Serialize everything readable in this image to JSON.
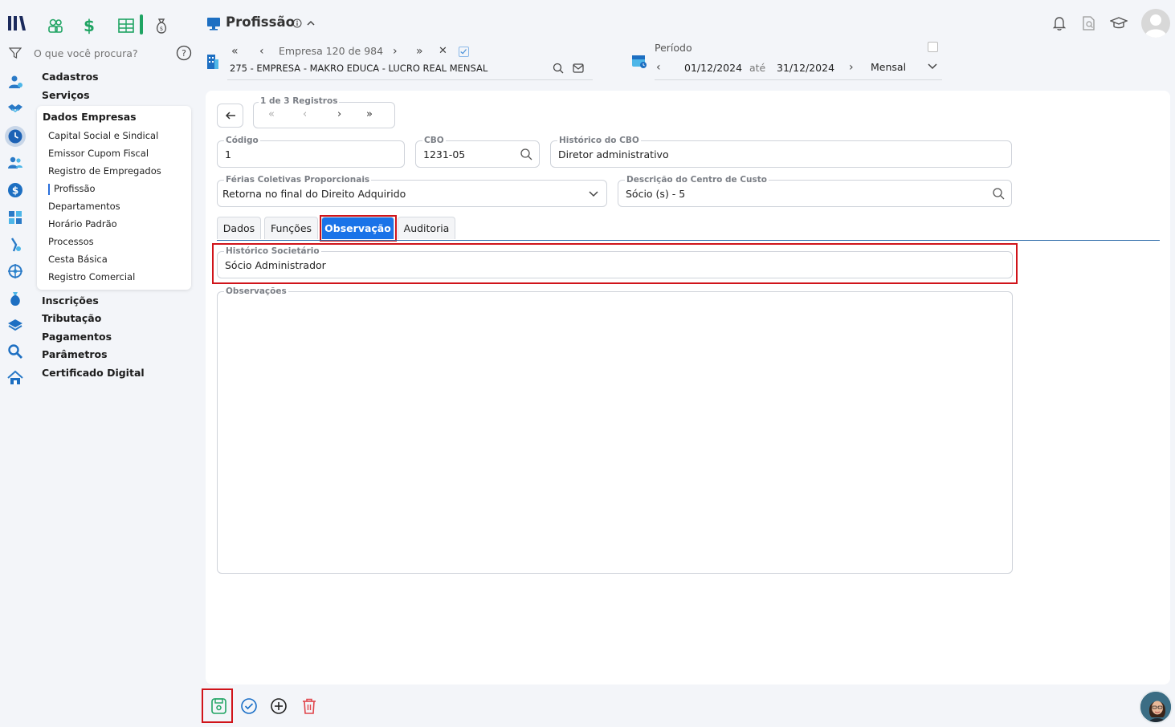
{
  "app": {
    "search_placeholder": "O que você procura?",
    "page_title": "Profissão"
  },
  "menu": {
    "items_top": [
      "Cadastros",
      "Serviços"
    ],
    "group_title": "Dados Empresas",
    "sub_items": [
      "Capital Social e Sindical",
      "Emissor Cupom Fiscal",
      "Registro de Empregados",
      "Profissão",
      "Departamentos",
      "Horário Padrão",
      "Processos",
      "Cesta Básica",
      "Registro Comercial"
    ],
    "items_bottom": [
      "Inscrições",
      "Tributação",
      "Pagamentos",
      "Parâmetros",
      "Certificado Digital"
    ]
  },
  "company_nav": {
    "label": "Empresa",
    "current": "120",
    "de": "de",
    "total": "984",
    "company_name": "275 - EMPRESA - MAKRO EDUCA - LUCRO REAL MENSAL"
  },
  "period": {
    "label": "Período",
    "start": "01/12/2024",
    "ate": "até",
    "end": "31/12/2024",
    "mode": "Mensal"
  },
  "records": {
    "label": "1 de 3 Registros"
  },
  "form": {
    "codigo": {
      "label": "Código",
      "value": "1"
    },
    "cbo": {
      "label": "CBO",
      "value": "1231-05"
    },
    "historico_cbo": {
      "label": "Histórico do CBO",
      "value": "Diretor administrativo"
    },
    "ferias": {
      "label": "Férias Coletivas Proporcionais",
      "value": "Retorna no final do Direito Adquirido"
    },
    "centro_custo": {
      "label": "Descrição do Centro de Custo",
      "value": "Sócio (s) - 5"
    },
    "historico_societario": {
      "label": "Histórico Societário",
      "value": "Sócio Administrador"
    },
    "observacoes": {
      "label": "Observações",
      "value": ""
    }
  },
  "tabs": [
    "Dados",
    "Funções",
    "Observação",
    "Auditoria"
  ],
  "colors": {
    "accent": "#1a73e8",
    "highlight": "#d0141a",
    "green": "#1fa463"
  }
}
